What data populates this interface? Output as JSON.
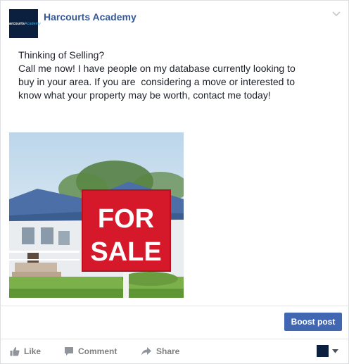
{
  "post": {
    "page_name": "Harcourts Academy",
    "avatar_logo": {
      "text_main": "Harcourts",
      "text_accent": "Academy"
    },
    "text_lines": [
      "Thinking of Selling?",
      "Call me now! I have people on my database currently looking to",
      "buy in your area. If you are  considering a move or interested to",
      "know what your property may be worth, contact me today!"
    ],
    "image": {
      "sign_line1": "FOR",
      "sign_line2": "SALE",
      "colors": {
        "sign": "#d5192b",
        "sky": "#cfe3f0",
        "roof": "#4b6fa6",
        "grass": "#7bb04a"
      }
    },
    "menu_icon": "chevron-down-icon"
  },
  "boost": {
    "label": "Boost post",
    "color": "#4267b2"
  },
  "actions": {
    "like_label": "Like",
    "comment_label": "Comment",
    "share_label": "Share",
    "icons": [
      "thumbs-up-icon",
      "comment-icon",
      "share-arrow-icon"
    ]
  },
  "page_selector": {
    "icon": "caret-down-icon"
  },
  "theme": {
    "link": "#365899",
    "muted": "#7f7f7f",
    "avatar_bg": "#0b1f3f"
  }
}
